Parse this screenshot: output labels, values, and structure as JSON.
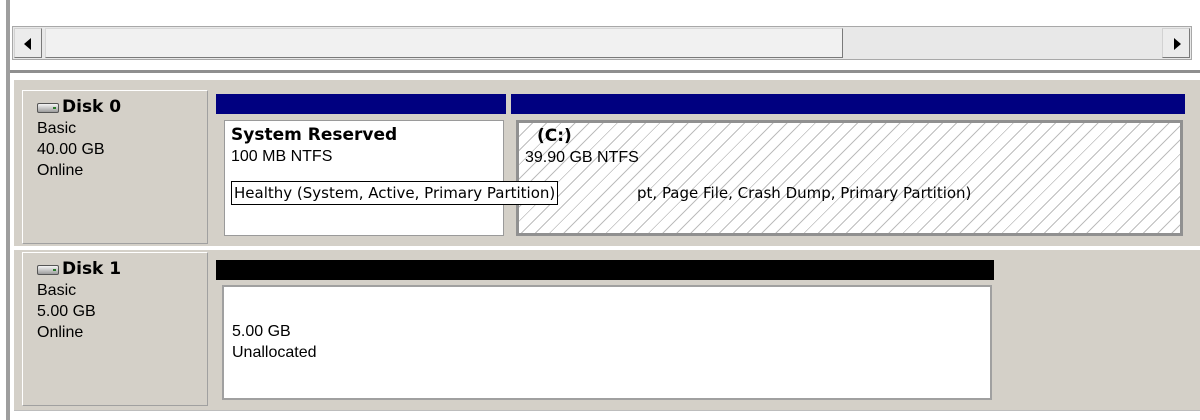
{
  "scrollbar": {
    "left_arrow": "scroll-left",
    "right_arrow": "scroll-right"
  },
  "disks": [
    {
      "title": "Disk 0",
      "type": "Basic",
      "size": "40.00 GB",
      "status": "Online",
      "partitions": [
        {
          "name": "System Reserved",
          "size_fs": "100 MB NTFS",
          "status": "Healthy (System, Active, Primary Partition)"
        },
        {
          "name": "(C:)",
          "size_fs": "39.90 GB NTFS",
          "status": "pt, Page File, Crash Dump, Primary Partition)"
        }
      ]
    },
    {
      "title": "Disk 1",
      "type": "Basic",
      "size": "5.00 GB",
      "status": "Online",
      "partitions": [
        {
          "size": "5.00 GB",
          "label": "Unallocated"
        }
      ]
    }
  ],
  "colors": {
    "primary_partition_bar": "#000080",
    "unallocated_bar": "#000000",
    "panel_bg": "#d4d0c8"
  }
}
